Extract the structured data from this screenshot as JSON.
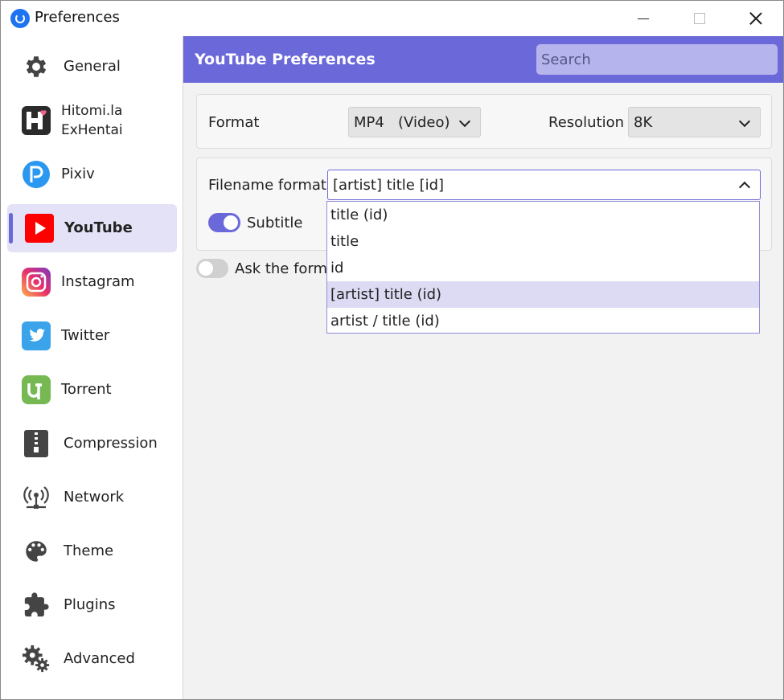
{
  "window": {
    "title": "Preferences"
  },
  "sidebar": {
    "items": [
      {
        "label": "General"
      },
      {
        "label": "Hitomi.la",
        "label2": "ExHentai"
      },
      {
        "label": "Pixiv"
      },
      {
        "label": "YouTube",
        "active": true
      },
      {
        "label": "Instagram"
      },
      {
        "label": "Twitter"
      },
      {
        "label": "Torrent"
      },
      {
        "label": "Compression"
      },
      {
        "label": "Network"
      },
      {
        "label": "Theme"
      },
      {
        "label": "Plugins"
      },
      {
        "label": "Advanced"
      }
    ]
  },
  "header": {
    "title": "YouTube Preferences",
    "search_placeholder": "Search"
  },
  "format": {
    "label": "Format",
    "value": "MP4   (Video)"
  },
  "resolution": {
    "label": "Resolution",
    "value": "8K"
  },
  "filename": {
    "label": "Filename format",
    "value": "[artist] title [id]"
  },
  "subtitle": {
    "label": "Subtitle",
    "enabled": true
  },
  "ask_format": {
    "label": "Ask the forma",
    "enabled": false
  },
  "dropdown": {
    "options": [
      "title (id)",
      "title",
      "id",
      "[artist] title (id)",
      "artist / title (id)"
    ],
    "highlighted": "[artist] title (id)"
  },
  "colors": {
    "accent": "#6b68d9",
    "active_bg": "#e3e2f6",
    "search_bg": "#b6b4ec"
  }
}
